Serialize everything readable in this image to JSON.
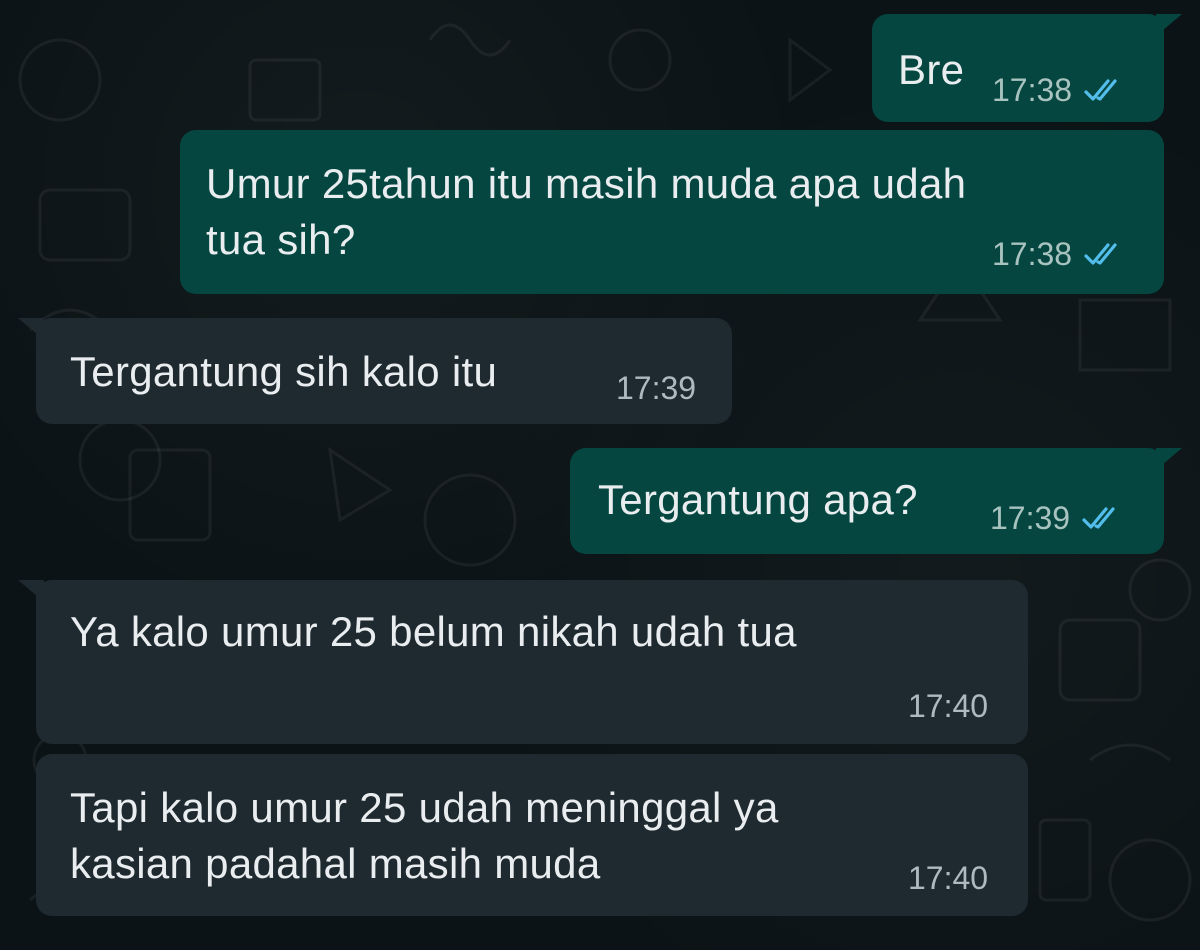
{
  "colors": {
    "background": "#0b1316",
    "outgoing_bubble": "#054740",
    "incoming_bubble": "#1f2a30",
    "text": "#e9edef",
    "read_ticks": "#53bdeb"
  },
  "messages": [
    {
      "direction": "out",
      "text": "Bre",
      "time": "17:38",
      "status_icon": "double-check-read-icon"
    },
    {
      "direction": "out",
      "text": "Umur 25tahun itu masih muda apa udah\ntua sih?",
      "time": "17:38",
      "status_icon": "double-check-read-icon"
    },
    {
      "direction": "in",
      "text": "Tergantung sih kalo itu",
      "time": "17:39"
    },
    {
      "direction": "out",
      "text": "Tergantung apa?",
      "time": "17:39",
      "status_icon": "double-check-read-icon"
    },
    {
      "direction": "in",
      "text": "Ya kalo umur 25 belum nikah udah tua",
      "time": "17:40"
    },
    {
      "direction": "in",
      "text": "Tapi kalo umur 25 udah meninggal ya\nkasian padahal masih muda",
      "time": "17:40"
    }
  ]
}
